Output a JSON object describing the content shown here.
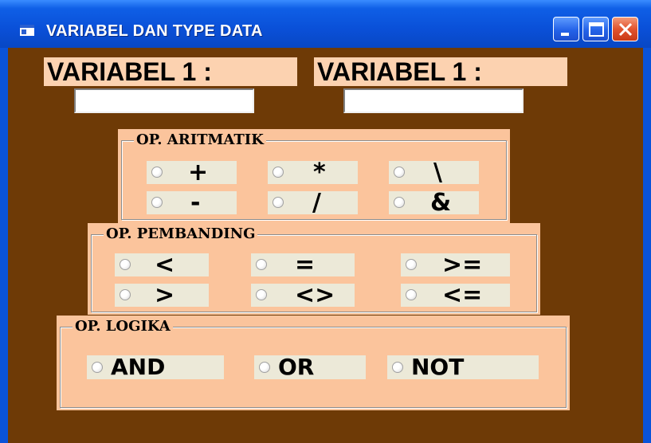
{
  "window": {
    "title": "VARIABEL DAN TYPE DATA"
  },
  "variables": [
    {
      "label": "VARIABEL 1 :",
      "value": ""
    },
    {
      "label": "VARIABEL 1 :",
      "value": ""
    }
  ],
  "frames": {
    "aritmatik": {
      "title": "OP. ARITMATIK",
      "options": [
        "+",
        "*",
        "\\",
        "-",
        "/",
        "&"
      ]
    },
    "pembanding": {
      "title": "OP. PEMBANDING",
      "options": [
        "<",
        "=",
        ">=",
        ">",
        "<>",
        "<="
      ]
    },
    "logika": {
      "title": "OP. LOGIKA",
      "options": [
        "AND",
        "OR",
        "NOT"
      ]
    }
  },
  "colors": {
    "form_background": "#6e3a06",
    "frame_background": "#fbc49c",
    "option_background": "#ece9d8",
    "titlebar": "#0a53d9",
    "close_button": "#e2532e"
  },
  "icons": [
    "app-icon",
    "minimize-icon",
    "maximize-icon",
    "close-icon"
  ]
}
